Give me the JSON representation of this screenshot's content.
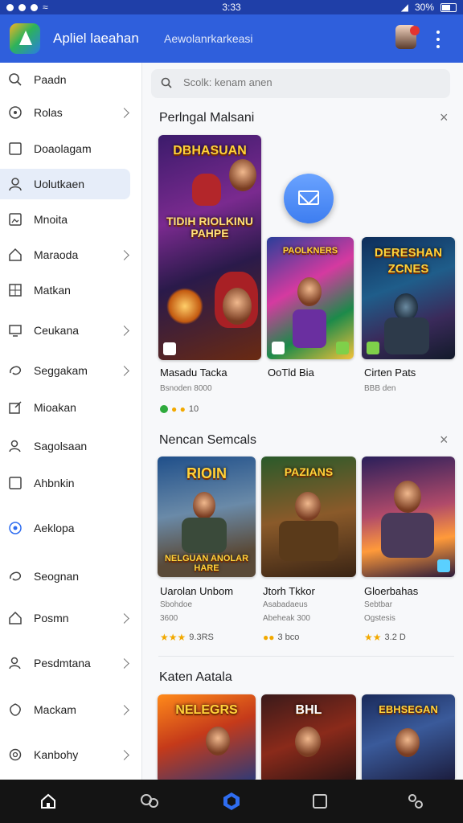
{
  "status": {
    "time": "3:33",
    "battery": "30%"
  },
  "app": {
    "title": "Apliel laeahan",
    "subtitle": "Aewolanrkarkeasi"
  },
  "search": {
    "placeholder": "Scolk: kenam anen"
  },
  "sidebar": {
    "items": [
      {
        "label": "Paadn",
        "icon": "search-icon",
        "chevron": false
      },
      {
        "label": "Rolas",
        "icon": "circle-icon",
        "chevron": true
      },
      {
        "label": "Doaolagam",
        "icon": "square-icon",
        "chevron": false
      },
      {
        "label": "Uolutkaen",
        "icon": "user-icon",
        "chevron": false,
        "active": true
      },
      {
        "label": "Mnoita",
        "icon": "image-icon",
        "chevron": false
      },
      {
        "label": "Maraoda",
        "icon": "home-icon",
        "chevron": true
      },
      {
        "label": "Matkan",
        "icon": "grid-icon",
        "chevron": false
      },
      {
        "label": "Ceukana",
        "icon": "monitor-icon",
        "chevron": true
      },
      {
        "label": "Seggakam",
        "icon": "loop-icon",
        "chevron": true
      },
      {
        "label": "Mioakan",
        "icon": "edit-icon",
        "chevron": false
      },
      {
        "label": "Sagolsaan",
        "icon": "person-icon",
        "chevron": false
      },
      {
        "label": "Ahbnkin",
        "icon": "square-icon",
        "chevron": false
      },
      {
        "label": "Aeklopa",
        "icon": "info-icon",
        "chevron": false
      },
      {
        "label": "Seognan",
        "icon": "loop-icon",
        "chevron": false
      },
      {
        "label": "Posmn",
        "icon": "home-icon",
        "chevron": true
      },
      {
        "label": "Pesdmtana",
        "icon": "person-icon",
        "chevron": true
      },
      {
        "label": "Mackam",
        "icon": "shield-icon",
        "chevron": true
      },
      {
        "label": "Kanbohy",
        "icon": "settings-icon",
        "chevron": true
      }
    ]
  },
  "sections": [
    {
      "title": "Perlngal Malsani",
      "games": [
        {
          "name": "Masadu Tacka",
          "meta": "Bsnoden 8000",
          "rating": "10",
          "art_title": "DBHASUAN",
          "art_subtitle": "TIDIH RIOLKINU PAHPE"
        },
        {
          "name": "OoTld Bia",
          "meta": "",
          "rating": "",
          "art_title": "PAOLKNERS",
          "art_subtitle": ""
        },
        {
          "name": "Cirten Pats",
          "meta": "BBB den",
          "rating": "",
          "art_title": "DERESHAN",
          "art_subtitle": "ZCNES"
        }
      ]
    },
    {
      "title": "Nencan Semcals",
      "games": [
        {
          "name": "Uarolan Unbom",
          "meta": "Sbohdoe",
          "meta2": "3600",
          "rating": "9.3RS",
          "art_title": "RIOIN",
          "art_subtitle": "NELGUAN ANOLAR HARE"
        },
        {
          "name": "Jtorh Tkkor",
          "meta": "Asabadaeus",
          "meta2": "Abeheak 300",
          "rating": "3 bco",
          "art_title": "PAZIANS",
          "art_subtitle": ""
        },
        {
          "name": "Gloerbahas",
          "meta": "Sebtbar",
          "meta2": "Ogstesis",
          "rating": "3.2 D",
          "art_title": "",
          "art_subtitle": ""
        }
      ]
    },
    {
      "title": "Katen Aatala",
      "games": [
        {
          "art_title": "NELEGRS"
        },
        {
          "art_title": "BHL"
        },
        {
          "art_title": "EBHSEGAN"
        }
      ]
    }
  ],
  "colors": {
    "appbar": "#2f5fdc",
    "statusbar": "#1f3fa8",
    "active_item": "#e6edf9",
    "fab": "#3d7df0"
  }
}
